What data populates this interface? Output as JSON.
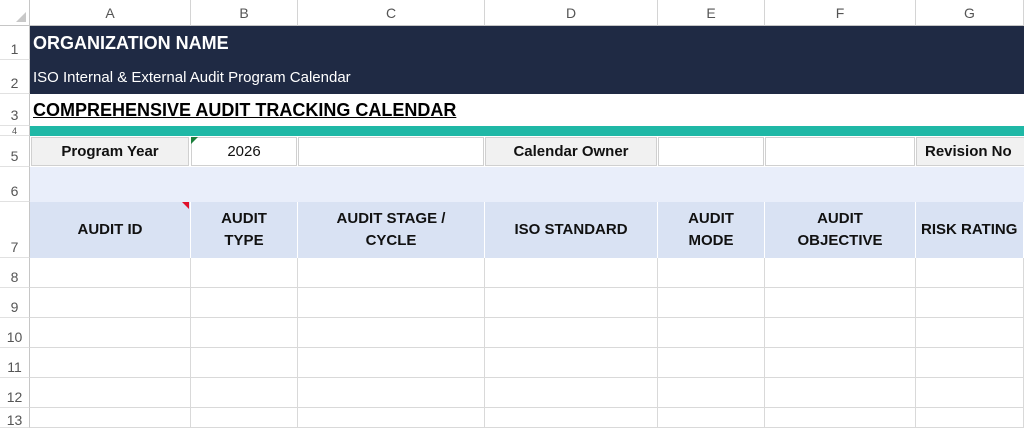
{
  "columns": [
    "A",
    "B",
    "C",
    "D",
    "E",
    "F",
    "G"
  ],
  "rows": [
    "1",
    "2",
    "3",
    "4",
    "5",
    "6",
    "7",
    "8",
    "9",
    "10",
    "11",
    "12",
    "13"
  ],
  "banner": {
    "org_name": "ORGANIZATION NAME",
    "subtitle": "ISO Internal & External Audit Program Calendar",
    "tracking_title": "COMPREHENSIVE AUDIT TRACKING CALENDAR",
    "accent_color": "#1fb8a6",
    "navy_color": "#1f2a44"
  },
  "info": {
    "program_year_label": "Program Year",
    "program_year_value": "2026",
    "calendar_owner_label": "Calendar Owner",
    "calendar_owner_value": "",
    "revision_label": "Revision No"
  },
  "table": {
    "headers": [
      "AUDIT ID",
      "AUDIT\nTYPE",
      "AUDIT STAGE /\nCYCLE",
      "ISO STANDARD",
      "AUDIT\nMODE",
      "AUDIT\nOBJECTIVE",
      "RISK RATING"
    ],
    "header_bg": "#d9e2f3"
  }
}
